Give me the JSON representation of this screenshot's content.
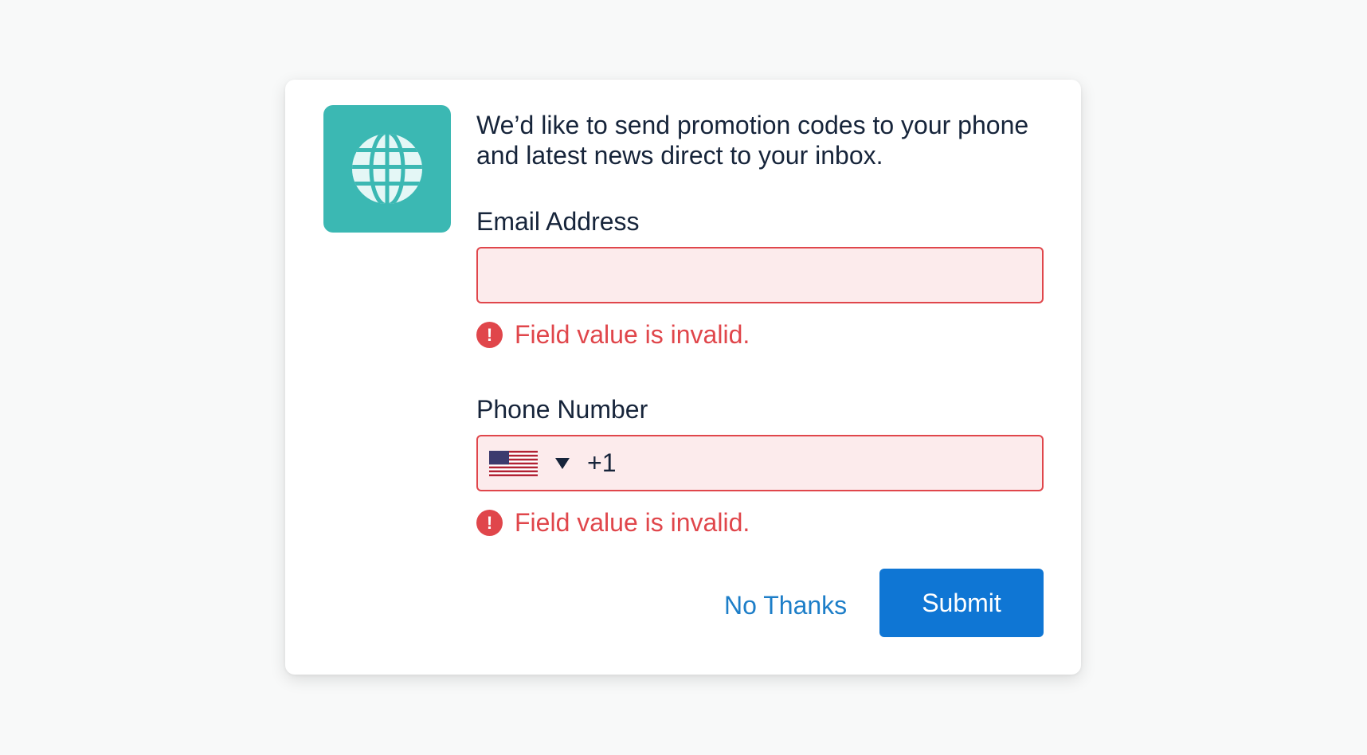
{
  "dialog": {
    "logo_icon": "globe-icon",
    "intro_text": "We’d like to send promotion codes to your phone and latest news direct to your inbox."
  },
  "email": {
    "label": "Email Address",
    "value": "",
    "error": "Field value is invalid."
  },
  "phone": {
    "label": "Phone Number",
    "country_flag": "us-flag-icon",
    "dial_code": "+1",
    "error": "Field value is invalid."
  },
  "actions": {
    "no_thanks_label": "No Thanks",
    "submit_label": "Submit"
  },
  "colors": {
    "accent": "#0f76d4",
    "logo_tile": "#3bb8b3",
    "error": "#e0464b",
    "error_fill": "#fcebec",
    "text": "#16243a",
    "link": "#1d7ec8"
  }
}
